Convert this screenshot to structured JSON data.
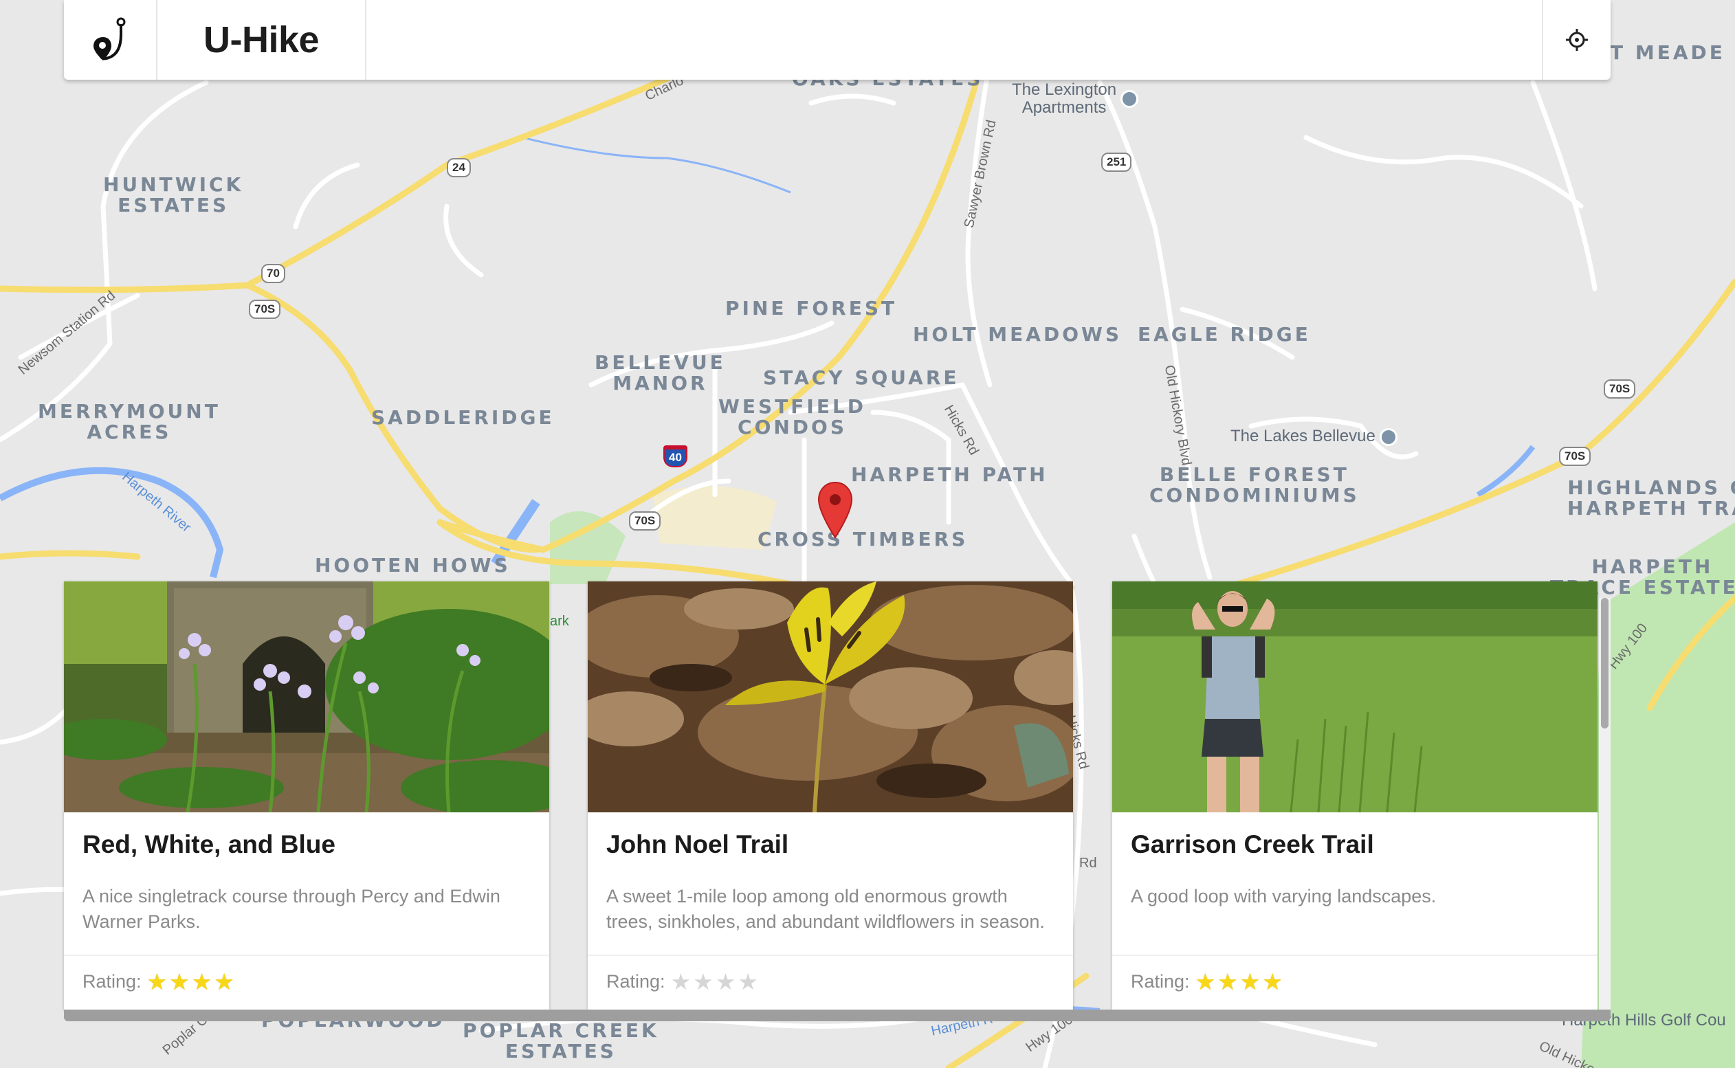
{
  "app": {
    "title": "U-Hike",
    "logo_icon": "hiker-pin-icon",
    "locate_icon": "crosshair-icon"
  },
  "map": {
    "places": [
      "HUNTWICK\nESTATES",
      "MERRYMOUNT\nACRES",
      "SADDLERIDGE",
      "BELLEVUE\nMANOR",
      "PINE FOREST",
      "HOLT MEADOWS",
      "EAGLE RIDGE",
      "STACY SQUARE",
      "WESTFIELD\nCONDOS",
      "HARPETH PATH",
      "BELLE FOREST\nCONDOMINIUMS",
      "CROSS TIMBERS",
      "HOOTEN HOWS",
      "HIGHLANDS O\nHARPETH TRA",
      "HARPETH\nTRACE ESTATES",
      "T MEADE",
      "POPLARWOOD",
      "POPLAR CREEK\nESTATES",
      "OAKS ESTATES"
    ],
    "pois": [
      "The Lexington\nApartments",
      "The Lakes Bellevue",
      "Harpeth Hills Golf Cou"
    ],
    "roads": [
      "Newsom Station Rd",
      "Harpeth River",
      "Sawyer Brown Rd",
      "Hicks Rd",
      "Old Hickory Blvd",
      "Hwy 100",
      "Poplar Creek",
      "Harpeth R",
      "Hwy 100",
      "Old Hicko",
      "Charlo",
      "ark",
      "Hicks Rd",
      "Rd"
    ],
    "shields": [
      "24",
      "70",
      "70S",
      "40",
      "70S",
      "251",
      "70S",
      "70S"
    ],
    "marker_icon": "map-marker-icon"
  },
  "trails": [
    {
      "title": "Red, White, and Blue",
      "description": "A nice singletrack course through Percy and Edwin Warner Parks.",
      "rating_label": "Rating:",
      "rating": 4,
      "max_rating": 4,
      "photo": "stone-arch-wildflowers-photo"
    },
    {
      "title": "John Noel Trail",
      "description": "A sweet 1-mile loop among old enormous growth trees, sinkholes, and abundant wildflowers in season.",
      "rating_label": "Rating:",
      "rating": 0,
      "max_rating": 4,
      "photo": "trout-lily-photo"
    },
    {
      "title": "Garrison Creek Trail",
      "description": "A good loop with varying landscapes.",
      "rating_label": "Rating:",
      "rating": 4,
      "max_rating": 4,
      "photo": "hiker-flexing-meadow-photo"
    }
  ],
  "colors": {
    "star_on": "#f7d718",
    "star_off": "#d6d6d6",
    "marker": "#e53935",
    "highway": "#f7dc6f",
    "river": "#8ab4f8",
    "park": "#b9e6a8"
  }
}
